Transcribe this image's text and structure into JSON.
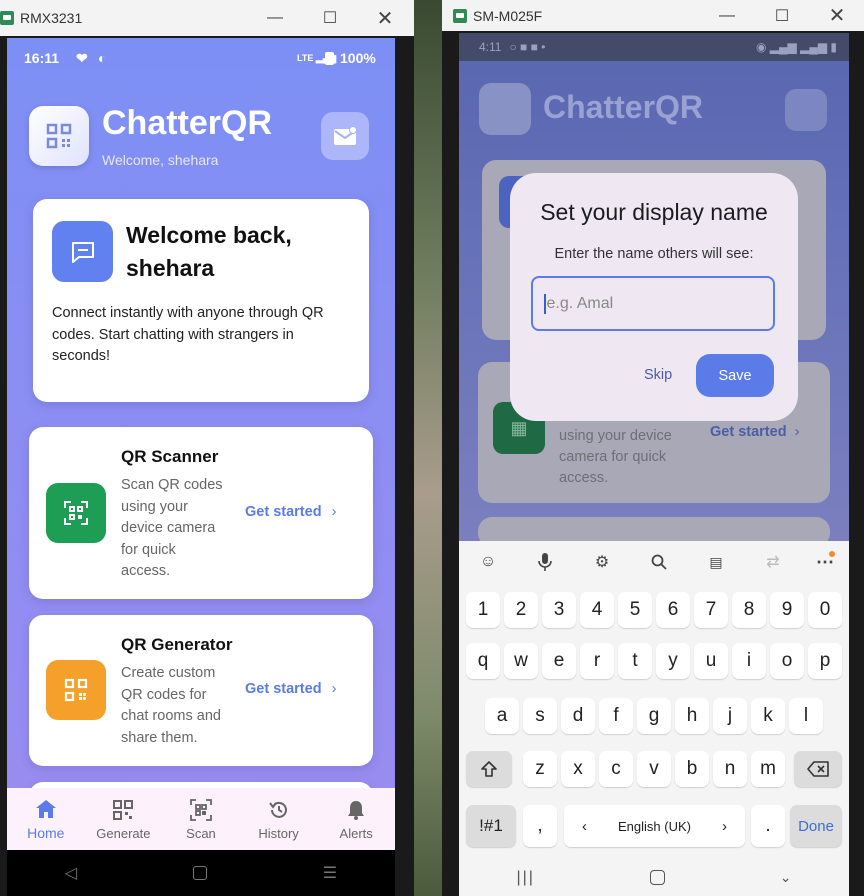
{
  "left_window": {
    "title": "RMX3231",
    "status": {
      "time": "16:11",
      "battery": "100%",
      "signal": "LTE"
    },
    "app": {
      "name": "ChatterQR",
      "subtitle": "Welcome, shehara"
    },
    "welcome": {
      "heading_line1": "Welcome back,",
      "heading_line2": "shehara",
      "text": "Connect instantly with anyone through QR codes. Start chatting with strangers in seconds!"
    },
    "features": [
      {
        "title": "QR Scanner",
        "desc_lines": [
          "Scan QR codes",
          "using your",
          "device camera",
          "for quick",
          "access."
        ],
        "cta": "Get started",
        "color": "#1e9e55"
      },
      {
        "title": "QR Generator",
        "desc_lines": [
          "Create custom",
          "QR codes for",
          "chat rooms and",
          "share them."
        ],
        "cta": "Get started",
        "color": "#f5a02a"
      }
    ],
    "nav": [
      {
        "label": "Home",
        "icon": "home-icon",
        "active": true
      },
      {
        "label": "Generate",
        "icon": "qr-icon",
        "active": false
      },
      {
        "label": "Scan",
        "icon": "scan-icon",
        "active": false
      },
      {
        "label": "History",
        "icon": "history-icon",
        "active": false
      },
      {
        "label": "Alerts",
        "icon": "bell-icon",
        "active": false
      }
    ]
  },
  "right_window": {
    "title": "SM-M025F",
    "status": {
      "time": "4:11"
    },
    "app": {
      "name": "ChatterQR"
    },
    "bg_card": {
      "cta": "Get started",
      "desc_lines": [
        "using your device",
        "camera for quick",
        "access."
      ]
    },
    "dialog": {
      "title": "Set your display name",
      "prompt": "Enter the name others will see:",
      "placeholder": "e.g. Amal",
      "skip": "Skip",
      "save": "Save"
    },
    "keyboard": {
      "numbers": [
        "1",
        "2",
        "3",
        "4",
        "5",
        "6",
        "7",
        "8",
        "9",
        "0"
      ],
      "row1": [
        "q",
        "w",
        "e",
        "r",
        "t",
        "y",
        "u",
        "i",
        "o",
        "p"
      ],
      "row2": [
        "a",
        "s",
        "d",
        "f",
        "g",
        "h",
        "j",
        "k",
        "l"
      ],
      "row3": [
        "z",
        "x",
        "c",
        "v",
        "b",
        "n",
        "m"
      ],
      "symbols": "!#1",
      "comma": ",",
      "language": "English (UK)",
      "period": ".",
      "done": "Done"
    }
  }
}
